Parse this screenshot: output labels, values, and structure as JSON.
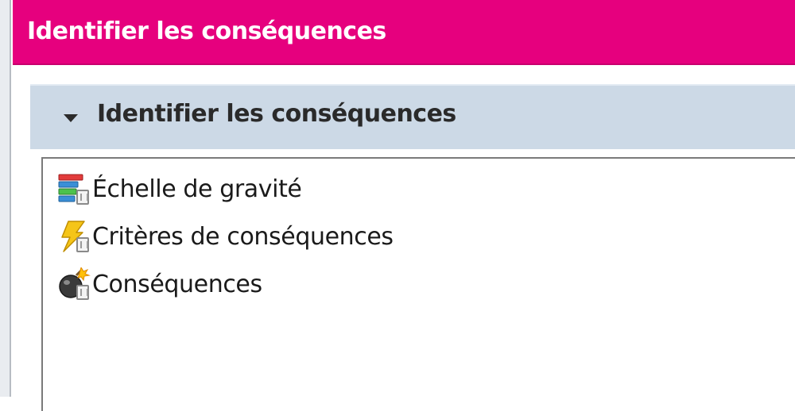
{
  "title_bar": {
    "title": "Identifier les conséquences",
    "color": "#e6007e"
  },
  "section": {
    "title": "Identifier les conséquences",
    "expanded": true,
    "color": "#ccd9e6"
  },
  "items": [
    {
      "label": "Échelle de gravité",
      "icon": "gravity-scale-icon"
    },
    {
      "label": "Critères de conséquences",
      "icon": "lightning-criteria-icon"
    },
    {
      "label": "Conséquences",
      "icon": "bomb-consequences-icon"
    }
  ]
}
